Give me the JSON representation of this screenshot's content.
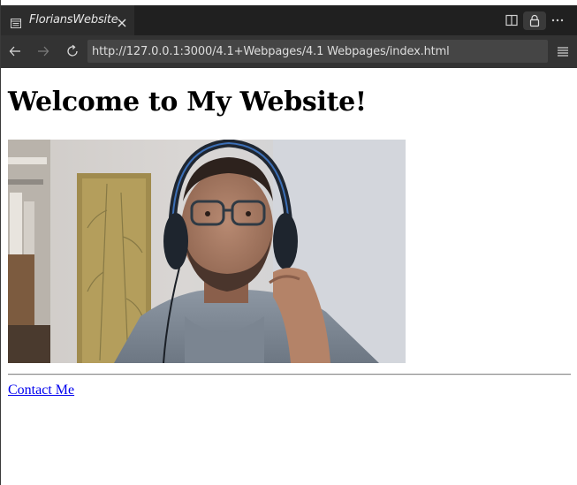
{
  "browser": {
    "tab": {
      "title": "FloriansWebsite",
      "icon": "page-icon",
      "close_icon": "close-icon"
    },
    "toolbar_icons": [
      "split-view-icon",
      "lock-icon",
      "more-icon"
    ],
    "nav": {
      "back_icon": "back-arrow-icon",
      "forward_icon": "forward-arrow-icon",
      "reload_icon": "reload-icon",
      "url": "http://127.0.0.1:3000/4.1+Webpages/4.1 Webpages/index.html",
      "menu_icon": "hamburger-menu-icon"
    },
    "colors": {
      "tabbar_bg": "#202020",
      "active_tab_bg": "#2c2c2c",
      "navbar_bg": "#333333",
      "urlbar_bg": "#454545",
      "link": "#0000ee"
    }
  },
  "page": {
    "heading": "Welcome to My Website!",
    "photo_alt": "profile-photo",
    "contact_link": "Contact Me"
  }
}
